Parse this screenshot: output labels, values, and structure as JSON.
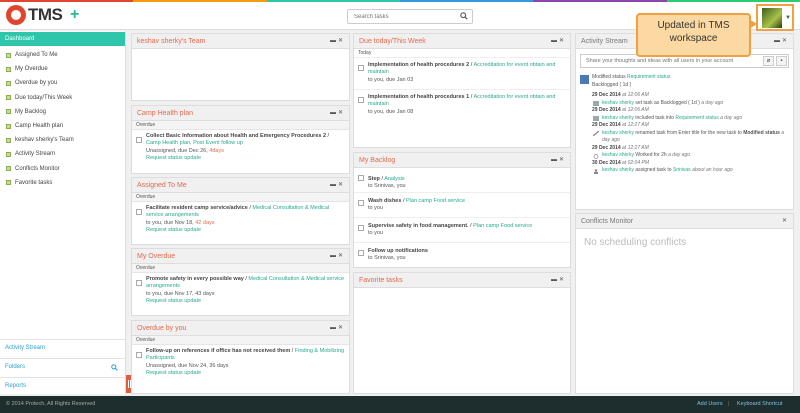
{
  "app": {
    "logo_text": "TMS"
  },
  "colors": {
    "accent": "#2ec6aa",
    "panel_title": "#e06a4c",
    "link": "#27a890",
    "footer_bg": "#1e2d2e",
    "top_strip": [
      "#e0462f",
      "#f39c12",
      "#2ec6aa",
      "#3498db",
      "#8e44ad",
      "#2ecc71"
    ]
  },
  "search": {
    "placeholder": "Search tasks"
  },
  "tooltip": {
    "text": "Updated in TMS workspace"
  },
  "sidebar": {
    "items": [
      {
        "label": "Dashboard"
      },
      {
        "label": "Assigned To Me"
      },
      {
        "label": "My Overdue"
      },
      {
        "label": "Overdue by you"
      },
      {
        "label": "Due today/This Week"
      },
      {
        "label": "My Backlog"
      },
      {
        "label": "Camp Health plan"
      },
      {
        "label": "keshav sherky's Team"
      },
      {
        "label": "Activity Stream"
      },
      {
        "label": "Conflicts Monitor"
      },
      {
        "label": "Favorite tasks"
      }
    ],
    "bottom": {
      "activity": "Activity Stream",
      "folders": "Folders",
      "reports": "Reports"
    }
  },
  "panels": {
    "team": {
      "title": "keshav sherky's Team"
    },
    "camp": {
      "title": "Camp Health plan",
      "sub": "Overdue",
      "task": {
        "title": "Collect Basic Information about Health and Emergency Procedures 2",
        "links": "Camp Health plan, Post Event follow up",
        "meta": "Unassigned, due Dec 26, ",
        "days": "4days",
        "req": "Request status update"
      }
    },
    "assigned": {
      "title": "Assigned To Me",
      "sub": "Overdue",
      "task": {
        "title": "Facilitate resident camp service/advice",
        "links": "Medical Consultation & Medical service arrangements",
        "meta": "to you, due Nov 18, ",
        "days": "42 days",
        "req": "Request status update"
      }
    },
    "myoverdue": {
      "title": "My Overdue",
      "sub": "Overdue",
      "task": {
        "title": "Promote safety in every possible way",
        "links": "Medical Consultation & Medical service arrangements",
        "meta": "to you, due Nov 17, 43 days",
        "req": "Request status update"
      }
    },
    "overdueby": {
      "title": "Overdue by you",
      "sub": "Overdue",
      "task": {
        "title": "Follow-up on references if office has not received them",
        "links": "Finding & Mobilizing Participants",
        "meta": "Unassigned, due Nov 24, 36 days",
        "req": "Request status update"
      }
    },
    "duetoday": {
      "title": "Due today/This Week",
      "sub": "Today",
      "tasks": [
        {
          "title": "Implementation of health procedures 2",
          "links": "Accreditation for event obtain and maintain",
          "meta": "to you, due Jan 03"
        },
        {
          "title": "Implementation of health procedures 1",
          "links": "Accreditation for event obtain and maintain",
          "meta": "to you, due Jan 08"
        }
      ]
    },
    "backlog": {
      "title": "My Backlog",
      "tasks": [
        {
          "title": "Step",
          "links": "Analysis",
          "meta": "to Srinivas, you"
        },
        {
          "title": "Wash dishes",
          "links": "Plan camp Food service",
          "meta": "to you"
        },
        {
          "title": "Supervise safety in food management.",
          "links": "Plan camp Food service",
          "meta": "to you"
        },
        {
          "title": "Follow up notifications",
          "links": "",
          "meta": "to Srinivas, you"
        }
      ]
    },
    "favorite": {
      "title": "Favorite tasks"
    },
    "activity": {
      "title": "Activity Stream",
      "input_placeholder": "Share your thoughts and ideas with all users in your account",
      "head": {
        "line1_pre": "Modified status ",
        "line1_link": "Requirement status",
        "line2": "Backlogged ( 1d )"
      },
      "entries": [
        {
          "date": "29 Dec 2014",
          "time": "at 12:06 AM",
          "user": "keshav sherky",
          "text": " set task as Backlogged ( 1d ) ",
          "ago": "a day ago"
        },
        {
          "date": "29 Dec 2014",
          "time": "at 12:06 AM",
          "user": "keshav sherky",
          "text": " included task into ",
          "link": "Requirement status",
          "ago": "a day ago"
        },
        {
          "date": "29 Dec 2014",
          "time": "at 12:27 AM",
          "user": "keshav sherky",
          "text": " renamed task from Enter title for the new task to ",
          "bold": "Modified status",
          "ago": "a day ago"
        },
        {
          "date": "29 Dec 2014",
          "time": "at 12:27 AM",
          "user": "keshav sherky",
          "text": " Worked for 2h ",
          "ago": "a day ago"
        },
        {
          "date": "30 Dec 2014",
          "time": "at 02:04 PM",
          "user": "keshav sherky",
          "text": " assigned task to ",
          "link": "Srinivas",
          "ago": "about an hour ago"
        }
      ]
    },
    "conflicts": {
      "title": "Conflicts Monitor",
      "empty": "No scheduling conflicts"
    }
  },
  "footer": {
    "copyright": "© 2014 Protech, All Rights Reserved",
    "add_users": "Add Users",
    "sep": "|",
    "shortcut": "Keyboard Shortcut"
  }
}
